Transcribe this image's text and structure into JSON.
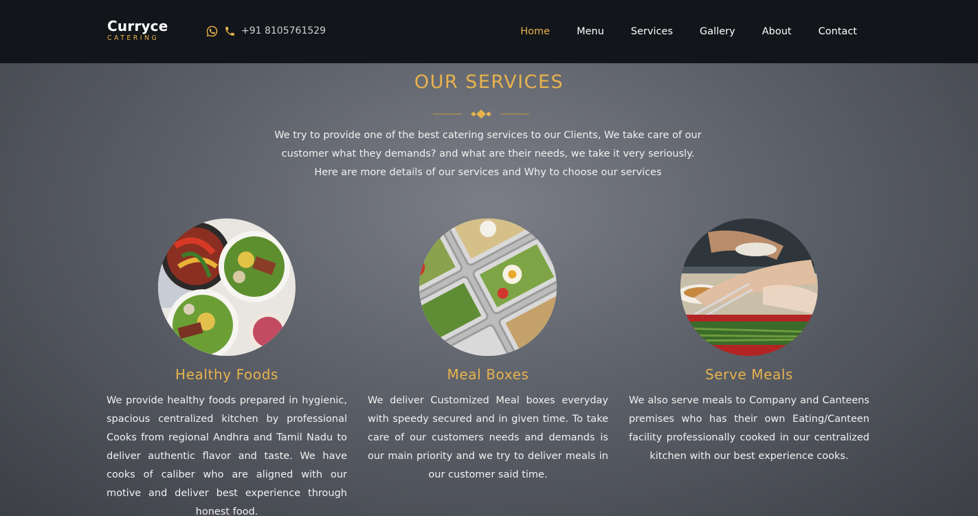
{
  "brand": {
    "name": "Curryce",
    "tagline": "CATERING"
  },
  "contact": {
    "phone": "+91 8105761529"
  },
  "nav": {
    "items": [
      {
        "label": "Home",
        "active": true
      },
      {
        "label": "Menu",
        "active": false
      },
      {
        "label": "Services",
        "active": false
      },
      {
        "label": "Gallery",
        "active": false
      },
      {
        "label": "About",
        "active": false
      },
      {
        "label": "Contact",
        "active": false
      }
    ]
  },
  "services": {
    "title": "OUR SERVICES",
    "intro": [
      "We try to provide one of the best catering services to our Clients, We take care of our",
      "customer what they demands? and what are their needs, we take it very seriously.",
      "Here are more details of our services and Why to choose our services"
    ],
    "cards": [
      {
        "title": "Healthy Foods",
        "image": "healthy-bowls-image",
        "text": "We provide healthy foods prepared in hygienic, spacious centralized kitchen by professional Cooks from regional Andhra and Tamil Nadu to deliver authentic flavor and taste. We have cooks of caliber who are aligned with our motive and deliver best experience through honest food."
      },
      {
        "title": "Meal Boxes",
        "image": "meal-boxes-image",
        "text": "We deliver Customized Meal boxes everyday with speedy secured and in given time. To take care of our customers needs and demands is our main priority and we try to deliver meals in our customer said time."
      },
      {
        "title": "Serve Meals",
        "image": "serving-meals-image",
        "text": "We also serve meals to Company and Canteens premises who has their own Eating/Canteen facility professionally cooked in our centralized kitchen with our best experience cooks."
      }
    ]
  },
  "colors": {
    "accent": "#e8b34e",
    "navbar": "#121519",
    "text": "#f2f2f2"
  },
  "icons": [
    "whatsapp-icon",
    "phone-icon",
    "diamond-divider-icon"
  ]
}
